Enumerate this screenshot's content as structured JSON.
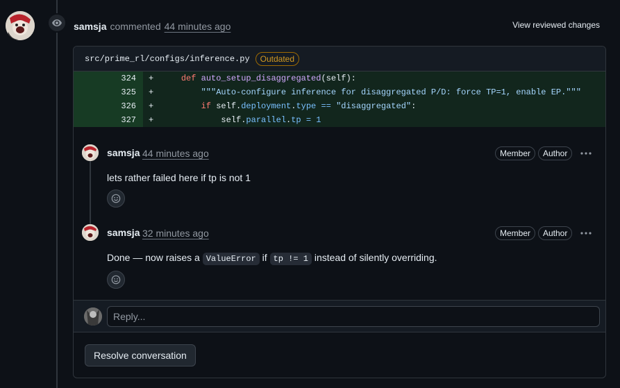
{
  "header": {
    "author": "samsja",
    "verb": "commented",
    "time": "44 minutes ago",
    "view_changes": "View reviewed changes"
  },
  "file": {
    "path": "src/prime_rl/configs/inference.py",
    "badge": "Outdated"
  },
  "diff": {
    "line_numbers": [
      "324",
      "325",
      "326",
      "327"
    ],
    "sign": "+"
  },
  "comments": [
    {
      "author": "samsja",
      "time": "44 minutes ago",
      "labels": [
        "Member",
        "Author"
      ],
      "body": "lets rather failed here if tp is not 1"
    },
    {
      "author": "samsja",
      "time": "32 minutes ago",
      "labels": [
        "Member",
        "Author"
      ],
      "body_parts": [
        "Done — now raises a",
        "ValueError",
        "if",
        "tp != 1",
        "instead of silently overriding."
      ]
    }
  ],
  "reply": {
    "placeholder": "Reply..."
  },
  "resolve_button": "Resolve conversation",
  "colors": {
    "added_bg": "#1b3a26",
    "outdated": "#d29922",
    "link_muted": "#9198a1"
  },
  "icons": [
    "eye-icon",
    "kebab-horizontal-icon",
    "smiley-icon"
  ]
}
